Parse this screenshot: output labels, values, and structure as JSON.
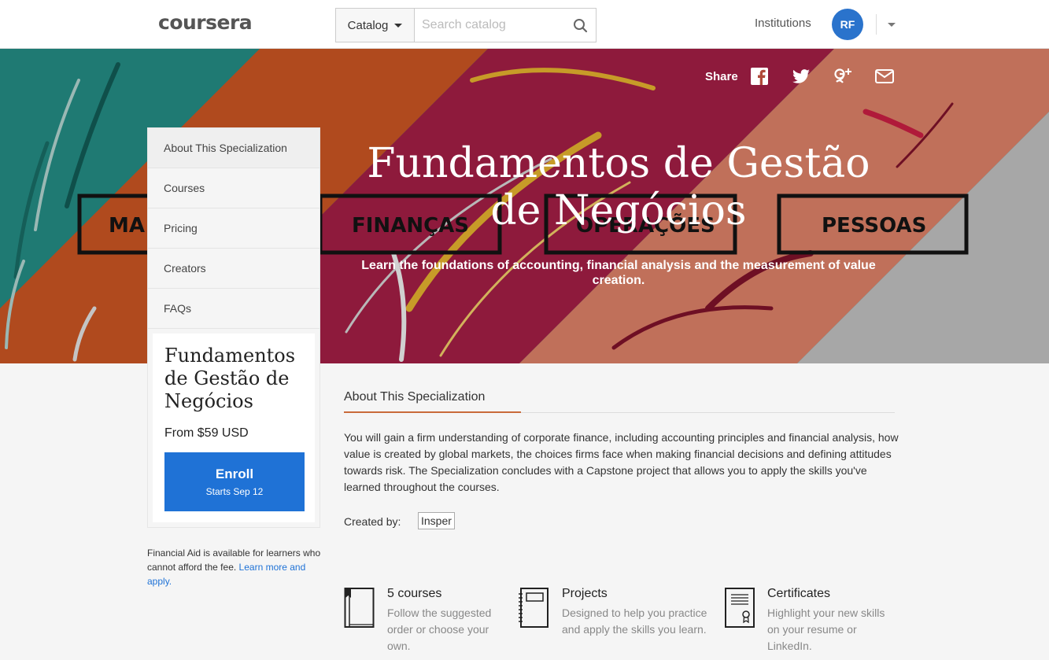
{
  "header": {
    "logo": "coursera",
    "catalog_label": "Catalog",
    "search_placeholder": "Search catalog",
    "institutions_label": "Institutions",
    "avatar_initials": "RF"
  },
  "hero": {
    "share_label": "Share",
    "title": "Fundamentos de Gestão de Negócios",
    "subtitle": "Learn the foundations of accounting, financial analysis and the measurement of value creation.",
    "banner_words": [
      "MA",
      "FINANÇAS",
      "OPERAÇÕES",
      "PESSOAS"
    ],
    "colors": {
      "teal": "#1f7a73",
      "orange": "#b04a1e",
      "crimson": "#8e1a3c",
      "salmon": "#c0705a",
      "gray": "#a7a7a7"
    }
  },
  "sidebar": {
    "items": [
      {
        "label": "About This Specialization"
      },
      {
        "label": "Courses"
      },
      {
        "label": "Pricing"
      },
      {
        "label": "Creators"
      },
      {
        "label": "FAQs"
      }
    ],
    "card": {
      "title": "Fundamentos de Gestão de Negócios",
      "price": "From $59 USD",
      "enroll_label": "Enroll",
      "enroll_sub": "Starts Sep 12"
    },
    "financial_aid_text": "Financial Aid is available for learners who cannot afford the fee.",
    "financial_aid_link": "Learn more and apply."
  },
  "main": {
    "tab_label": "About This Specialization",
    "description": "You will gain a firm understanding of corporate finance, including accounting principles and financial analysis, how value is created by global markets, the choices firms face when making financial decisions and defining attitudes towards risk. The Specialization concludes with a Capstone project that allows you to apply the skills you've learned throughout the courses.",
    "created_by_label": "Created by:",
    "creator": "Insper",
    "features": [
      {
        "icon": "book-icon",
        "title": "5 courses",
        "desc": "Follow the suggested order or choose your own."
      },
      {
        "icon": "notebook-icon",
        "title": "Projects",
        "desc": "Designed to help you practice and apply the skills you learn."
      },
      {
        "icon": "certificate-icon",
        "title": "Certificates",
        "desc": "Highlight your new skills on your resume or LinkedIn."
      }
    ]
  }
}
